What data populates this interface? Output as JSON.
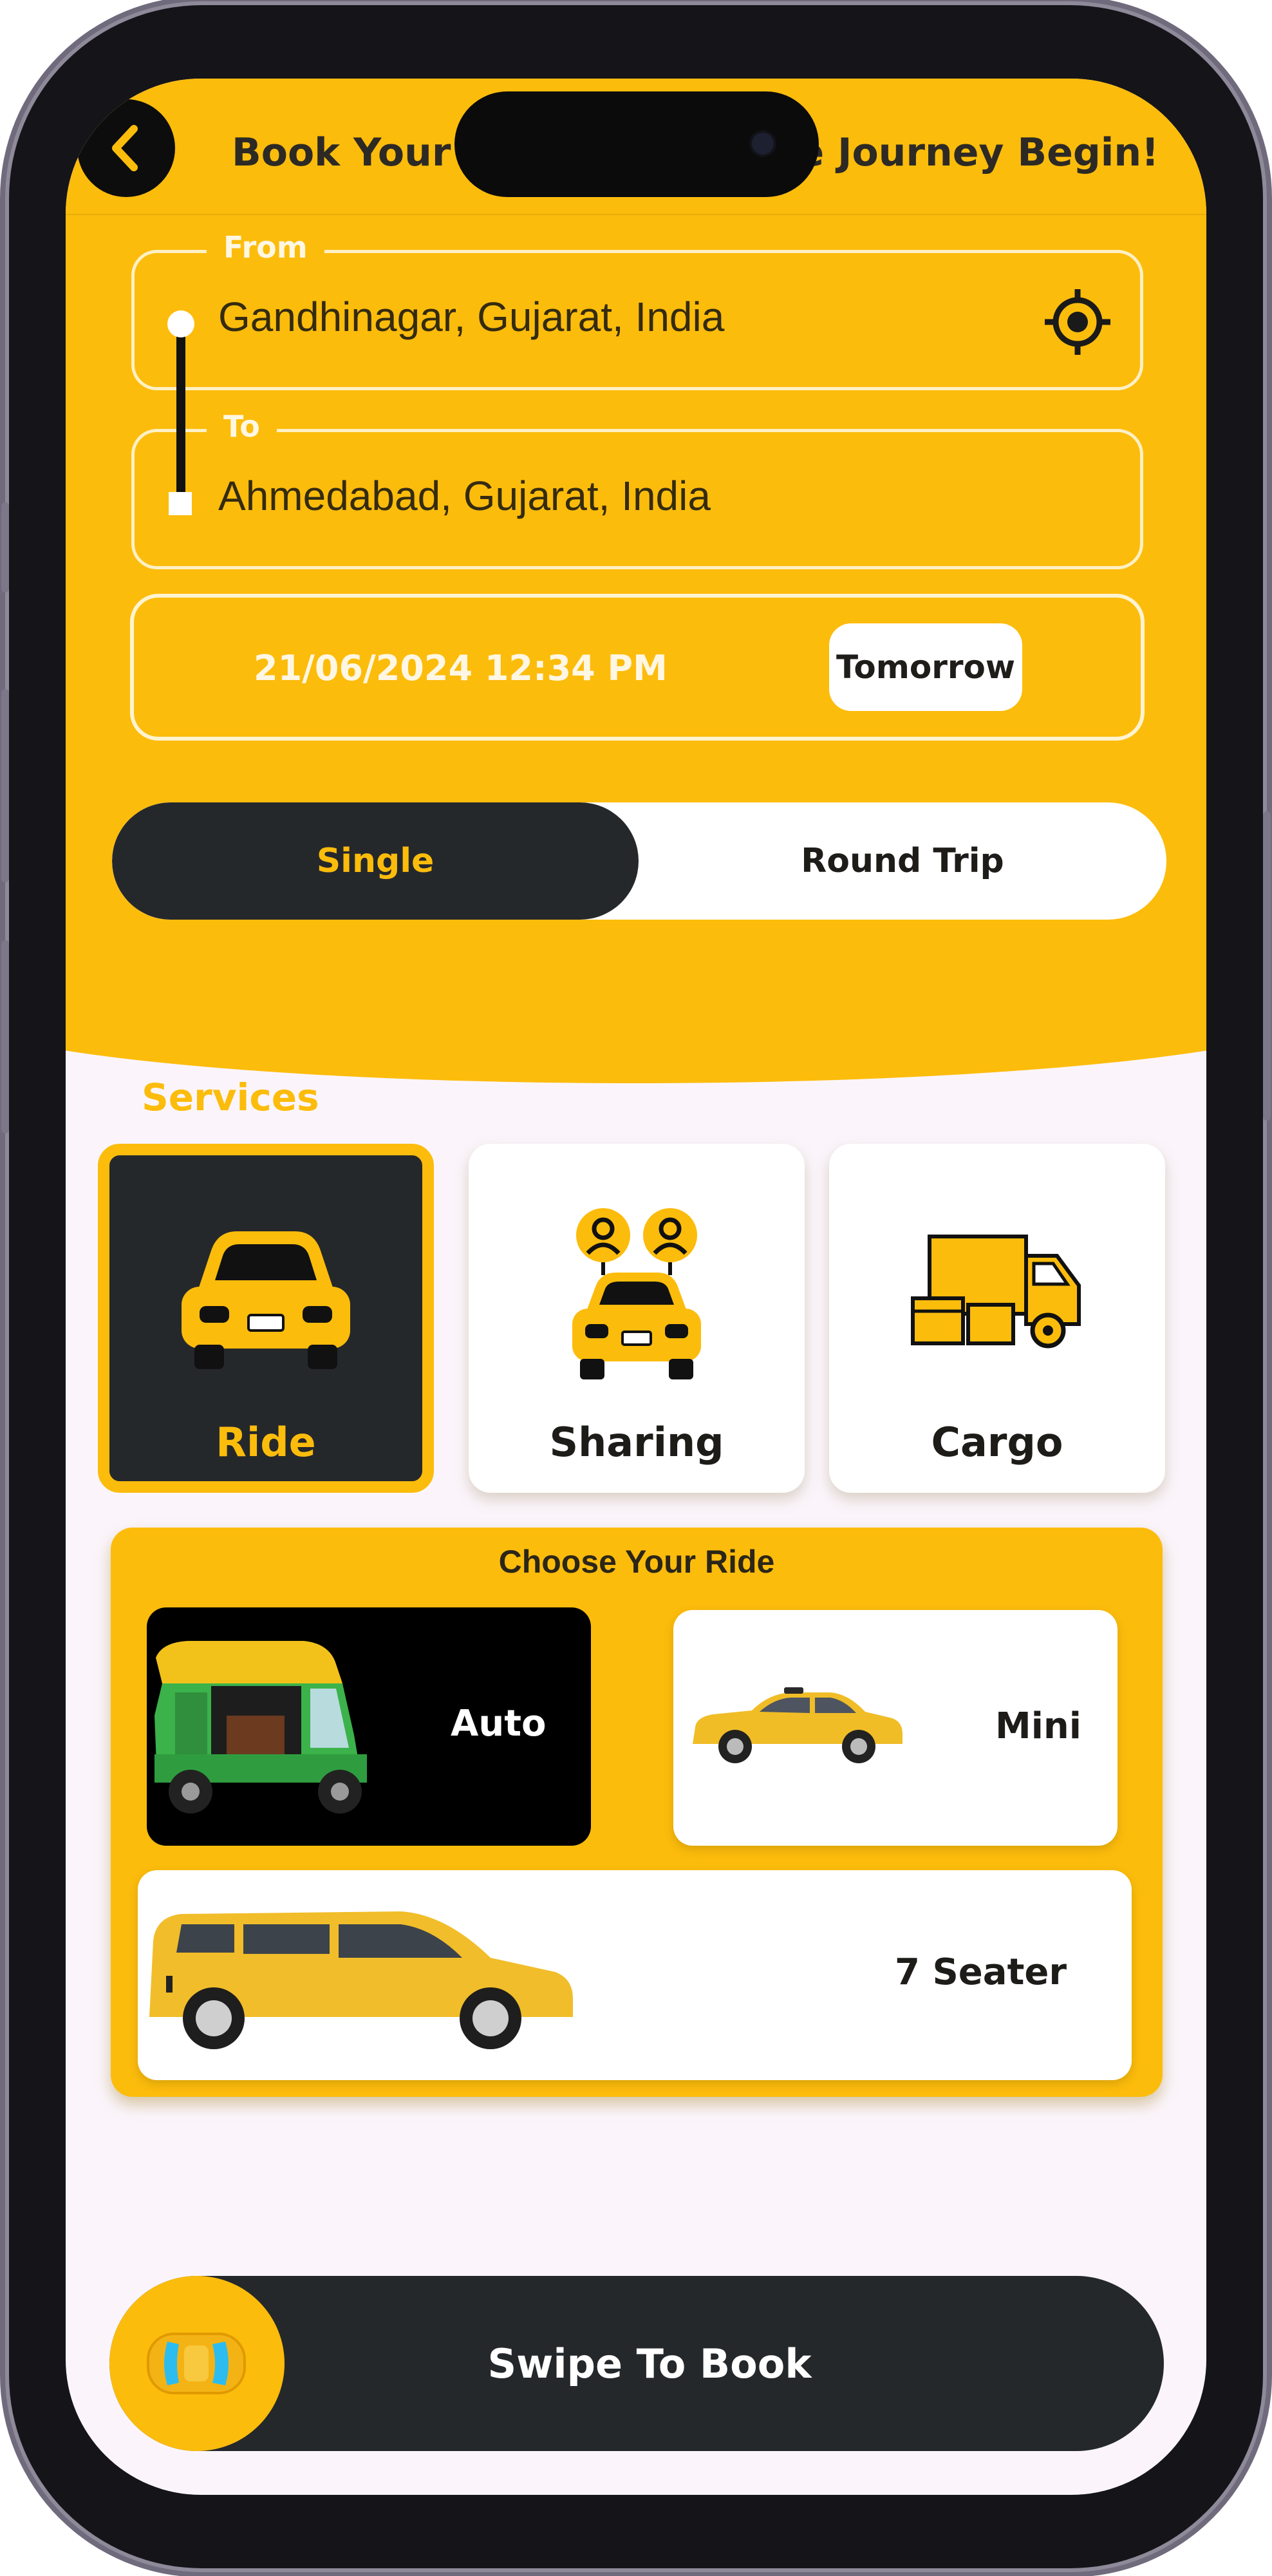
{
  "header": {
    "title": "Book Your Ride and Let the Journey Begin!",
    "back_icon": "chevron-left-icon"
  },
  "trip": {
    "from_label": "From",
    "from_value": "Gandhinagar, Gujarat, India",
    "to_label": "To",
    "to_value": "Ahmedabad, Gujarat, India",
    "location_icon": "crosshair-location-icon",
    "datetime": "21/06/2024 12:34 PM",
    "tomorrow_label": "Tomorrow"
  },
  "trip_type": {
    "options": [
      "Single",
      "Round Trip"
    ],
    "selected": "Single"
  },
  "services": {
    "heading": "Services",
    "items": [
      {
        "label": "Ride",
        "icon": "car-front-icon",
        "selected": true
      },
      {
        "label": "Sharing",
        "icon": "shared-car-icon",
        "selected": false
      },
      {
        "label": "Cargo",
        "icon": "cargo-truck-icon",
        "selected": false
      }
    ]
  },
  "rides": {
    "heading": "Choose Your Ride",
    "items": [
      {
        "label": "Auto",
        "icon": "auto-rickshaw-icon",
        "selected": true
      },
      {
        "label": "Mini",
        "icon": "sedan-icon",
        "selected": false
      },
      {
        "label": "7 Seater",
        "icon": "minivan-icon",
        "selected": false
      }
    ]
  },
  "swipe": {
    "label": "Swipe To Book",
    "knob_icon": "car-top-view-icon"
  },
  "colors": {
    "accent": "#fcbc0c",
    "dark": "#25282b",
    "background": "#fbf5fb"
  }
}
